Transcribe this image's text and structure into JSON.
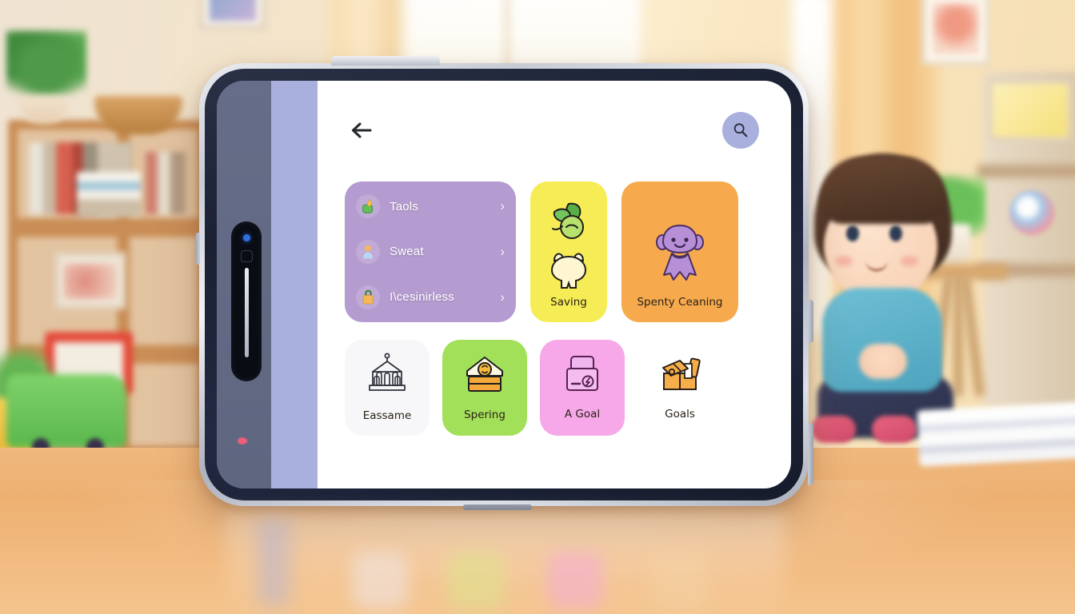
{
  "device": {
    "type": "tablet",
    "frame_color": "#1b2133",
    "edge_color": "#c7cbd5",
    "left_panel_color": "#656d88",
    "accent_strip_color": "#aab0dd"
  },
  "app": {
    "header": {
      "back_label": "←",
      "back_icon": "arrow-left-icon",
      "search_icon": "search-icon",
      "search_button_color": "#aab0dd"
    },
    "list_card": {
      "background": "#b49bd0",
      "items": [
        {
          "label": "Taols",
          "icon": "flame-bag-icon",
          "chevron": "›"
        },
        {
          "label": "Sweat",
          "icon": "person-icon",
          "chevron": "›"
        },
        {
          "label": "I\\cesinirless",
          "icon": "lock-bag-icon",
          "chevron": "›"
        }
      ]
    },
    "top_tiles": [
      {
        "label": "Saving",
        "background": "#f6ec56",
        "icons": [
          "leaf-coin-icon",
          "piggy-bank-icon"
        ]
      },
      {
        "label": "Spenty Ceaning",
        "background": "#f7aa4d",
        "icons": [
          "robot-mascot-icon"
        ]
      }
    ],
    "bottom_tiles": [
      {
        "label": "Eassame",
        "background": "#f7f7fa",
        "icon": "bank-building-icon"
      },
      {
        "label": "Spering",
        "background": "#a3e05a",
        "icon": "piggy-house-icon"
      },
      {
        "label": "A Goal",
        "background": "#f7a8e8",
        "icon": "mailbox-icon"
      },
      {
        "label": "Goals",
        "background": "#ffffff",
        "icon": "gift-boxes-icon"
      }
    ]
  },
  "scene": {
    "setting": "blurred playroom background",
    "elements": [
      "bookshelf",
      "potted-plant",
      "woven-basket",
      "framed-pictures",
      "green-toy-truck",
      "window-with-curtains",
      "seated-child",
      "shelving-unit",
      "stacked-books",
      "wooden-table"
    ]
  }
}
